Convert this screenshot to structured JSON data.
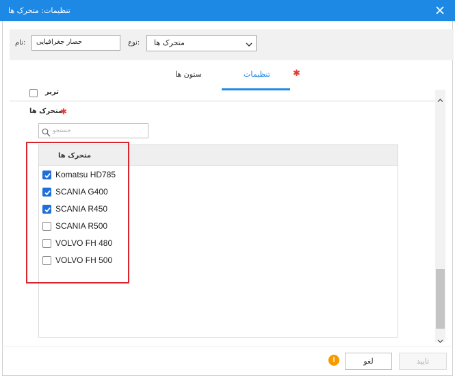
{
  "window": {
    "title": "تنظیمات: متحرک ها"
  },
  "header": {
    "name_label": "نام:",
    "name_value": "حصار جغرافیایی",
    "type_label": "نوع:",
    "type_value": "متحرک ها"
  },
  "tabs": [
    {
      "label": "ستون ها",
      "active": false
    },
    {
      "label": "تنظیمات",
      "active": true
    }
  ],
  "settings": {
    "partial_checkbox_label": "تریر",
    "section_title": "متحرک ها",
    "search_placeholder": "جستجو",
    "grid_header": "متحرک ها",
    "items": [
      {
        "label": "Komatsu HD785",
        "checked": true
      },
      {
        "label": "SCANIA G400",
        "checked": true
      },
      {
        "label": "SCANIA R450",
        "checked": true
      },
      {
        "label": "SCANIA R500",
        "checked": false
      },
      {
        "label": "VOLVO FH 480",
        "checked": false
      },
      {
        "label": "VOLVO FH 500",
        "checked": false
      }
    ]
  },
  "footer": {
    "warning_symbol": "!",
    "cancel_label": "لغو",
    "confirm_label": "تایید"
  },
  "colors": {
    "accent": "#1e88e5",
    "required_star": "#e53935",
    "highlight_box": "#d9262c",
    "warning": "#f59b00",
    "checkbox_checked": "#1e6fd9"
  }
}
